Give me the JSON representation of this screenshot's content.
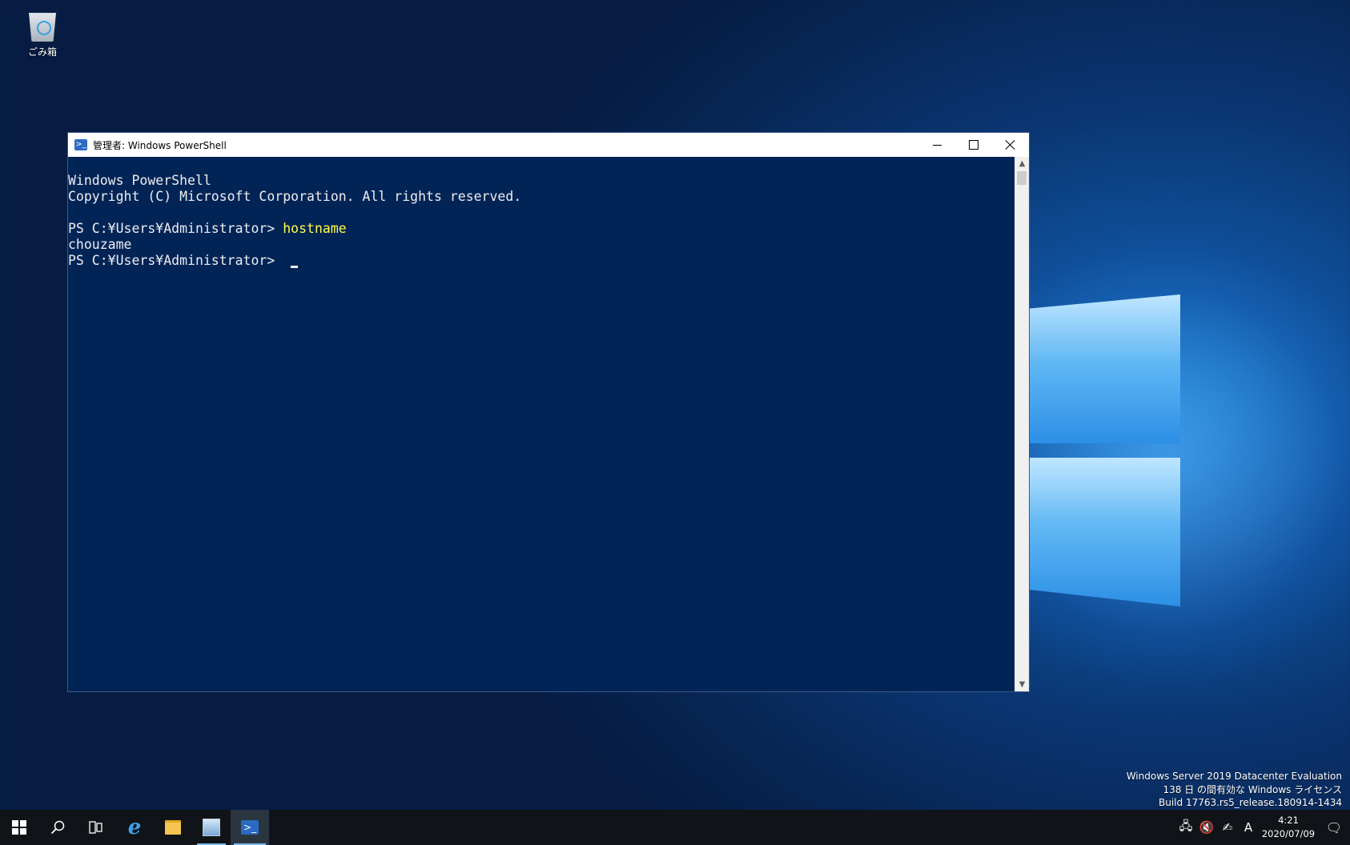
{
  "desktop": {
    "recycle_bin_label": "ごみ箱",
    "watermark": {
      "line1": "Windows Server 2019 Datacenter Evaluation",
      "line2": "138 日 の間有効な Windows ライセンス",
      "line3": "Build 17763.rs5_release.180914-1434"
    }
  },
  "window": {
    "title": "管理者: Windows PowerShell",
    "console": {
      "line1": "Windows PowerShell",
      "line2": "Copyright (C) Microsoft Corporation. All rights reserved.",
      "prompt1": "PS C:¥Users¥Administrator> ",
      "command1": "hostname",
      "output1": "chouzame",
      "prompt2": "PS C:¥Users¥Administrator> "
    },
    "colors": {
      "console_bg": "#012456",
      "command": "#ffff4a",
      "text": "#eeedf0"
    }
  },
  "taskbar": {
    "icons": [
      "windows-start-icon",
      "search-icon",
      "task-view-icon",
      "internet-explorer-icon",
      "file-explorer-icon",
      "server-manager-icon",
      "powershell-icon"
    ],
    "tray": {
      "ime_label": "A",
      "time": "4:21",
      "date": "2020/07/09"
    }
  }
}
